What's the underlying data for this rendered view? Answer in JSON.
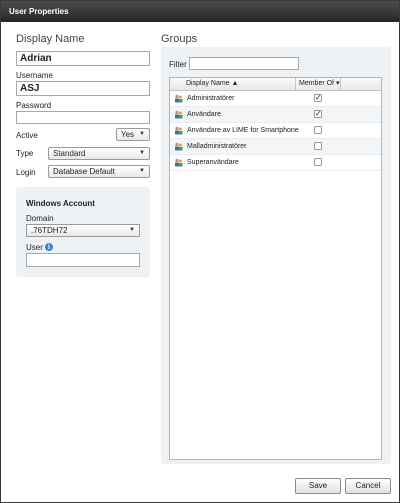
{
  "window": {
    "title": "User Properties"
  },
  "left": {
    "display_name_title": "Display Name",
    "display_name_value": "Adrian",
    "username_label": "Username",
    "username_value": "ASJ",
    "password_label": "Password",
    "password_value": "",
    "active_label": "Active",
    "active_value": "Yes",
    "type_label": "Type",
    "type_value": "Standard",
    "login_label": "Login",
    "login_value": "Database Default",
    "windows_account": {
      "title": "Windows Account",
      "domain_label": "Domain",
      "domain_value": ".76TDH72",
      "user_label": "User",
      "user_value": ""
    }
  },
  "groups": {
    "title": "Groups",
    "filter_label": "Filter",
    "filter_value": "",
    "columns": {
      "display_name": "Display Name ▲",
      "member_of": "Member Of ▾"
    },
    "rows": [
      {
        "name": "Administratörer",
        "member": "✓"
      },
      {
        "name": "Användare",
        "member": "✓"
      },
      {
        "name": "Användare av LIME for Smartphone",
        "member": ""
      },
      {
        "name": "Malladministratörer",
        "member": ""
      },
      {
        "name": "Superanvändare",
        "member": ""
      }
    ]
  },
  "footer": {
    "save_label": "Save",
    "cancel_label": "Cancel"
  },
  "icons": {
    "dropdown": "chevron-down-icon",
    "info": "info-icon",
    "group": "group-icon"
  },
  "colors": {
    "titlebar": "#333333",
    "panel": "#eef2f5",
    "info": "#3a82d6"
  }
}
